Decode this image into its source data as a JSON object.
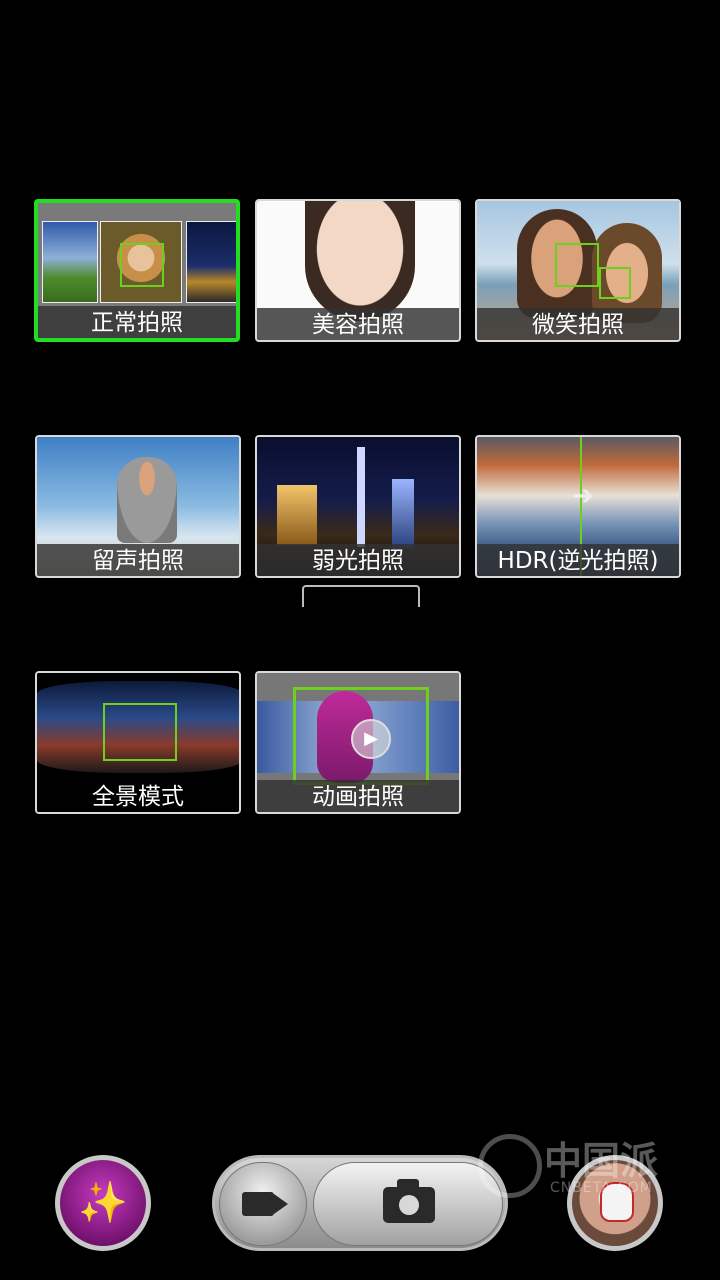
{
  "modes": [
    {
      "id": "normal",
      "label": "正常拍照",
      "selected": true
    },
    {
      "id": "beauty",
      "label": "美容拍照",
      "selected": false
    },
    {
      "id": "smile",
      "label": "微笑拍照",
      "selected": false
    },
    {
      "id": "voice",
      "label": "留声拍照",
      "selected": false
    },
    {
      "id": "lowlight",
      "label": "弱光拍照",
      "selected": false
    },
    {
      "id": "hdr",
      "label": "HDR(逆光拍照)",
      "selected": false
    },
    {
      "id": "panorama",
      "label": "全景模式",
      "selected": false
    },
    {
      "id": "animation",
      "label": "动画拍照",
      "selected": false
    }
  ],
  "watermark": {
    "title": "中国派",
    "site": "CNBETA.COM"
  },
  "icons": {
    "effects": "magic-wand-icon",
    "video": "video-camera-icon",
    "photo": "camera-icon",
    "gallery": "gallery-thumbnail"
  },
  "colors": {
    "selected_border": "#22dd22",
    "face_box": "#6fcf1f"
  }
}
